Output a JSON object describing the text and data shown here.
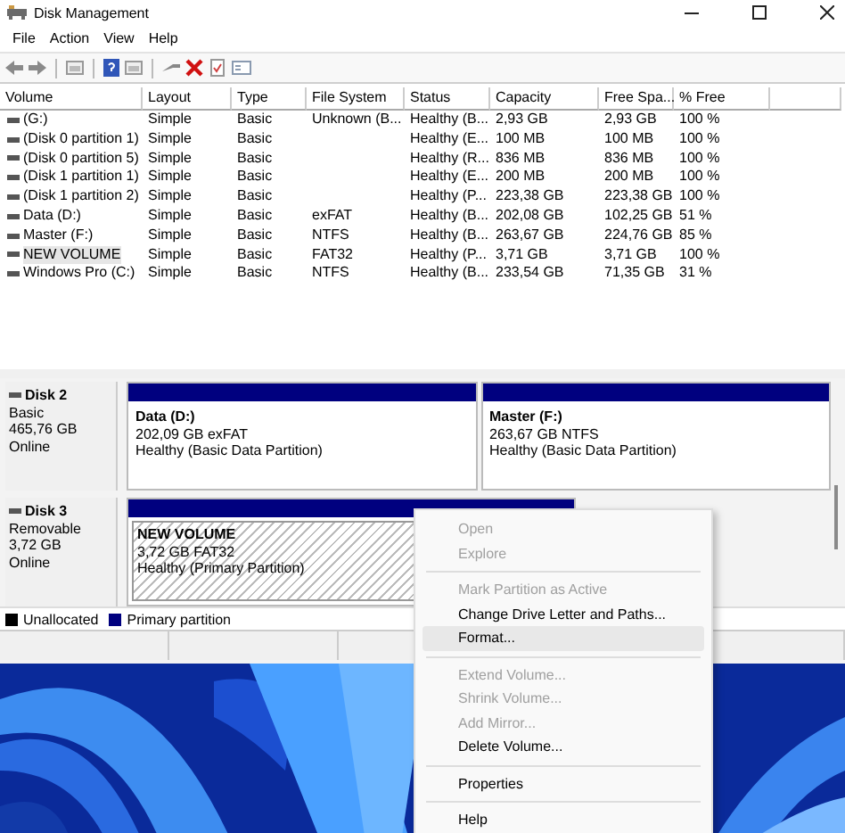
{
  "window": {
    "title": "Disk Management"
  },
  "menu": [
    "File",
    "Action",
    "View",
    "Help"
  ],
  "volume_table": {
    "columns": [
      "Volume",
      "Layout",
      "Type",
      "File System",
      "Status",
      "Capacity",
      "Free Spa...",
      "% Free"
    ],
    "rows": [
      {
        "cells": [
          "(G:)",
          "Simple",
          "Basic",
          "Unknown (B...",
          "Healthy (B...",
          "2,93 GB",
          "2,93 GB",
          "100 %"
        ],
        "selected": false
      },
      {
        "cells": [
          "(Disk 0 partition 1)",
          "Simple",
          "Basic",
          "",
          "Healthy (E...",
          "100 MB",
          "100 MB",
          "100 %"
        ],
        "selected": false
      },
      {
        "cells": [
          "(Disk 0 partition 5)",
          "Simple",
          "Basic",
          "",
          "Healthy (R...",
          "836 MB",
          "836 MB",
          "100 %"
        ],
        "selected": false
      },
      {
        "cells": [
          "(Disk 1 partition 1)",
          "Simple",
          "Basic",
          "",
          "Healthy (E...",
          "200 MB",
          "200 MB",
          "100 %"
        ],
        "selected": false
      },
      {
        "cells": [
          "(Disk 1 partition 2)",
          "Simple",
          "Basic",
          "",
          "Healthy (P...",
          "223,38 GB",
          "223,38 GB",
          "100 %"
        ],
        "selected": false
      },
      {
        "cells": [
          "Data (D:)",
          "Simple",
          "Basic",
          "exFAT",
          "Healthy (B...",
          "202,08 GB",
          "102,25 GB",
          "51 %"
        ],
        "selected": false
      },
      {
        "cells": [
          "Master (F:)",
          "Simple",
          "Basic",
          "NTFS",
          "Healthy (B...",
          "263,67 GB",
          "224,76 GB",
          "85 %"
        ],
        "selected": false
      },
      {
        "cells": [
          "NEW VOLUME",
          "Simple",
          "Basic",
          "FAT32",
          "Healthy (P...",
          "3,71 GB",
          "3,71 GB",
          "100 %"
        ],
        "selected": true
      },
      {
        "cells": [
          "Windows Pro  (C:)",
          "Simple",
          "Basic",
          "NTFS",
          "Healthy (B...",
          "233,54 GB",
          "71,35 GB",
          "31 %"
        ],
        "selected": false
      }
    ]
  },
  "disks": [
    {
      "name": "Disk 2",
      "type": "Basic",
      "size": "465,76 GB",
      "status": "Online",
      "partitions": [
        {
          "name": "Data  (D:)",
          "detail": "202,09 GB exFAT",
          "status": "Healthy (Basic Data Partition)",
          "selected": false
        },
        {
          "name": "Master  (F:)",
          "detail": "263,67 GB NTFS",
          "status": "Healthy (Basic Data Partition)",
          "selected": false
        }
      ]
    },
    {
      "name": "Disk 3",
      "type": "Removable",
      "size": "3,72 GB",
      "status": "Online",
      "partitions": [
        {
          "name": "NEW VOLUME",
          "detail": "3,72 GB FAT32",
          "status": "Healthy (Primary Partition)",
          "selected": true
        }
      ]
    }
  ],
  "legend": [
    {
      "label": "Unallocated",
      "color": "#000000"
    },
    {
      "label": "Primary partition",
      "color": "#00007f"
    }
  ],
  "context_menu": [
    {
      "kind": "item",
      "label": "Open",
      "disabled": true,
      "selected": false
    },
    {
      "kind": "item",
      "label": "Explore",
      "disabled": true,
      "selected": false
    },
    {
      "kind": "separator"
    },
    {
      "kind": "item",
      "label": "Mark Partition as Active",
      "disabled": true,
      "selected": false
    },
    {
      "kind": "item",
      "label": "Change Drive Letter and Paths...",
      "disabled": false,
      "selected": false
    },
    {
      "kind": "item",
      "label": "Format...",
      "disabled": false,
      "selected": true
    },
    {
      "kind": "separator"
    },
    {
      "kind": "item",
      "label": "Extend Volume...",
      "disabled": true,
      "selected": false
    },
    {
      "kind": "item",
      "label": "Shrink Volume...",
      "disabled": true,
      "selected": false
    },
    {
      "kind": "item",
      "label": "Add Mirror...",
      "disabled": true,
      "selected": false
    },
    {
      "kind": "item",
      "label": "Delete Volume...",
      "disabled": false,
      "selected": false
    },
    {
      "kind": "separator"
    },
    {
      "kind": "item",
      "label": "Properties",
      "disabled": false,
      "selected": false
    },
    {
      "kind": "separator"
    },
    {
      "kind": "item",
      "label": "Help",
      "disabled": false,
      "selected": false
    }
  ]
}
